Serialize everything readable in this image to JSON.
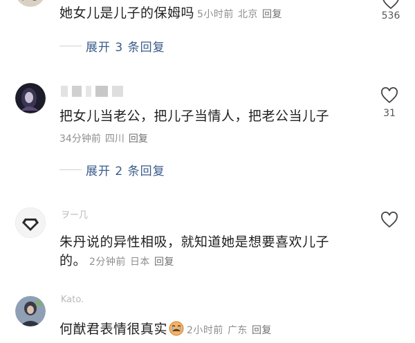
{
  "comments": [
    {
      "text": "她女儿是儿子的保姆吗",
      "time": "5小时前",
      "location": "北京",
      "reply": "回复",
      "likes": "536",
      "expand": "展开 3 条回复"
    },
    {
      "text": "把女儿当老公，把儿子当情人，把老公当儿子",
      "time": "34分钟前",
      "location": "四川",
      "reply": "回复",
      "likes": "31",
      "expand": "展开 2 条回复"
    },
    {
      "username": "ヲー几",
      "text_line1": "朱丹说的异性相吸，就知道她是想要喜欢儿子",
      "text_line2": "的。",
      "time": "2分钟前",
      "location": "日本",
      "reply": "回复"
    },
    {
      "username": "Kato.",
      "text": "何猷君表情很真实",
      "time": "2小时前",
      "location": "广东",
      "reply": "回复"
    }
  ],
  "icons": {
    "like": "heart-outline-icon",
    "emoji": "crying-face-emoji"
  },
  "colors": {
    "expand_link": "#3a5b8a",
    "meta": "#8e8e8e",
    "text": "#1f1f1f"
  }
}
